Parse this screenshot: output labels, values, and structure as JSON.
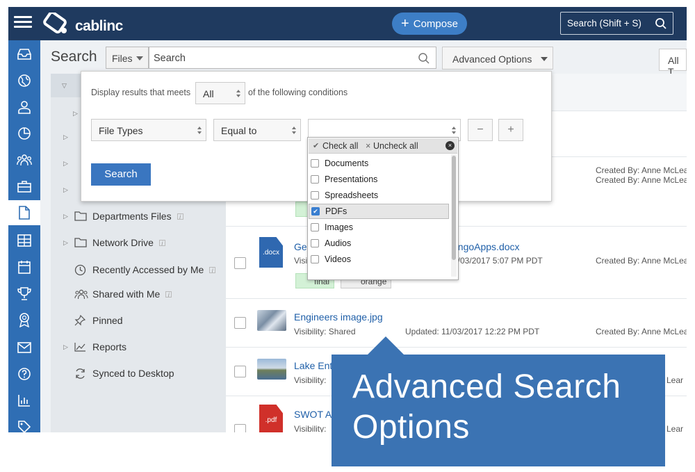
{
  "topbar": {
    "logo": "cablinc",
    "compose_label": "Compose",
    "search_label": "Search (Shift + S)"
  },
  "search": {
    "title": "Search",
    "filter_value": "Files",
    "placeholder": "Search",
    "advanced_label": "Advanced Options",
    "all_label": "All T"
  },
  "advanced": {
    "prefix": "Display results that meets",
    "match_value": "All",
    "suffix": "of the following conditions",
    "field_value": "File Types",
    "operator_value": "Equal to",
    "value": "",
    "minus": "−",
    "plus": "+",
    "search_label": "Search",
    "dropdown": {
      "check_all": "Check all",
      "uncheck_all": "Uncheck all",
      "options": [
        {
          "label": "Documents",
          "checked": false
        },
        {
          "label": "Presentations",
          "checked": false
        },
        {
          "label": "Spreadsheets",
          "checked": false
        },
        {
          "label": "PDFs",
          "checked": true
        },
        {
          "label": "Images",
          "checked": false
        },
        {
          "label": "Audios",
          "checked": false
        },
        {
          "label": "Videos",
          "checked": false
        }
      ]
    }
  },
  "tree": [
    {
      "label": "Departments Files",
      "icon": "folder-icon"
    },
    {
      "label": "Network Drive",
      "icon": "folder-icon"
    },
    {
      "label": "Recently Accessed by Me",
      "icon": "clock-icon"
    },
    {
      "label": "Shared with Me",
      "icon": "users-icon"
    },
    {
      "label": "Pinned",
      "icon": "pin-icon"
    },
    {
      "label": "Reports",
      "icon": "chart-icon"
    },
    {
      "label": "Synced to Desktop",
      "icon": "sync-icon"
    }
  ],
  "files": {
    "row1": {
      "created": "Created By: Anne McLear"
    },
    "row2": {
      "created": "Created By: Anne McLear"
    },
    "row3": {
      "name_start": "Ge",
      "name_end": "angoApps.docx",
      "visibility": "Visi",
      "updated": "1/03/2017 5:07 PM PDT",
      "created": "Created By: Anne McLear",
      "tag1": "final",
      "tag2": "orange",
      "thumb": ".docx"
    },
    "row4": {
      "name": "Engineers image.jpg",
      "visibility": "Visibility: Shared",
      "updated": "Updated: 11/03/2017 12:22 PM PDT",
      "created": "Created By: Anne McLear"
    },
    "row5": {
      "name": "Lake Ent",
      "visibility": "Visibility:",
      "created": "Lear"
    },
    "row6": {
      "name": "SWOT As",
      "visibility": "Visibility:",
      "created": "Lear",
      "thumb": ".pdf"
    }
  },
  "callout": {
    "text": "Advanced Search Options"
  },
  "colors": {
    "topbar": "#1f3a5f",
    "sidebar": "#2f6eb4",
    "accent": "#3b73b3",
    "link": "#1f5fa8"
  }
}
